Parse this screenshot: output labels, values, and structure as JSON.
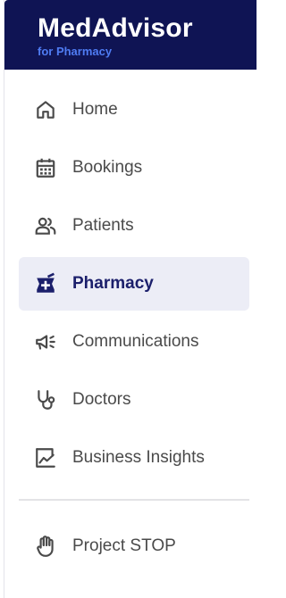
{
  "brand": {
    "name": "MedAdvisor",
    "subtitle": "for Pharmacy",
    "colors": {
      "header_bg": "#0f1454",
      "subtitle": "#4f7cf3"
    }
  },
  "nav": {
    "items": [
      {
        "label": "Home",
        "icon": "home-icon",
        "active": false
      },
      {
        "label": "Bookings",
        "icon": "calendar-icon",
        "active": false
      },
      {
        "label": "Patients",
        "icon": "users-icon",
        "active": false
      },
      {
        "label": "Pharmacy",
        "icon": "pharmacy-icon",
        "active": true
      },
      {
        "label": "Communications",
        "icon": "megaphone-icon",
        "active": false
      },
      {
        "label": "Doctors",
        "icon": "stethoscope-icon",
        "active": false
      },
      {
        "label": "Business Insights",
        "icon": "insights-chart-icon",
        "active": false
      }
    ],
    "secondary": [
      {
        "label": "Project STOP",
        "icon": "hand-stop-icon",
        "active": false
      }
    ],
    "colors": {
      "active_bg": "#ecedf6",
      "active_text": "#1b1f6b",
      "text": "#4a4a4a",
      "icon": "#4a4a4a"
    }
  }
}
